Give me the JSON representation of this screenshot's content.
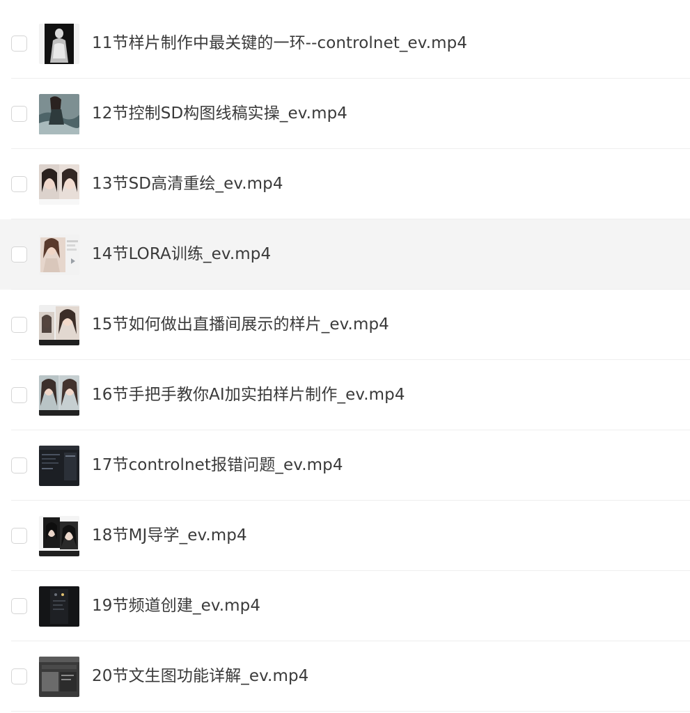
{
  "files": [
    {
      "name": "11节样片制作中最关键的一环--controlnet_ev.mp4",
      "thumbnail": "statue-thumbnail"
    },
    {
      "name": "12节控制SD构图线稿实操_ev.mp4",
      "thumbnail": "portrait-water-thumbnail"
    },
    {
      "name": "13节SD高清重绘_ev.mp4",
      "thumbnail": "portrait-pair-thumbnail"
    },
    {
      "name": "14节LORA训练_ev.mp4",
      "thumbnail": "portrait-screen-thumbnail"
    },
    {
      "name": "15节如何做出直播间展示的样片_ev.mp4",
      "thumbnail": "portrait-compare-thumbnail"
    },
    {
      "name": "16节手把手教你AI加实拍样片制作_ev.mp4",
      "thumbnail": "portrait-duo-thumbnail"
    },
    {
      "name": "17节controlnet报错问题_ev.mp4",
      "thumbnail": "dark-screen-thumbnail"
    },
    {
      "name": "18节MJ导学_ev.mp4",
      "thumbnail": "portrait-bw-thumbnail"
    },
    {
      "name": "19节频道创建_ev.mp4",
      "thumbnail": "dark-app-thumbnail"
    },
    {
      "name": "20节文生图功能详解_ev.mp4",
      "thumbnail": "ui-screen-thumbnail"
    }
  ],
  "highlighted_row": 3
}
